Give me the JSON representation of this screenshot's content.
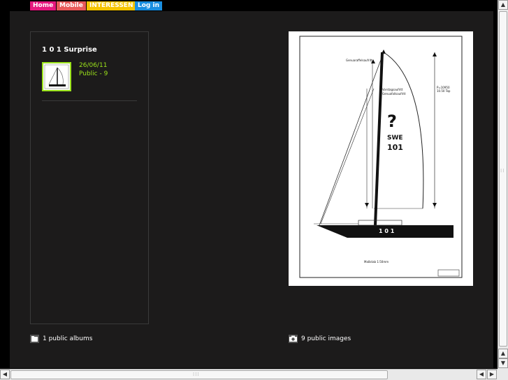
{
  "nav": [
    {
      "label": "Home",
      "color": "#e6197f"
    },
    {
      "label": "Mobile",
      "color": "#e85a5a"
    },
    {
      "label": "INTERESSEN",
      "color": "#f5c400"
    },
    {
      "label": "Log in",
      "color": "#1a8ee0"
    }
  ],
  "album": {
    "title": "1 0 1 Surprise",
    "date": "26/06/11",
    "visibility": "Public - 9",
    "thumbnail_icon": "sailboat-drawing-icon"
  },
  "image": {
    "drawing_labels": {
      "sail_number_country": "SWE",
      "sail_number": "101",
      "hull_number": "1 0 1",
      "caption": "Maßstab 1:50mm",
      "top_label": "Genuaraffelsaufritt",
      "mid_label_a": "Vorstagsaufritt",
      "mid_label_b": "Genuafallsaufritt",
      "right_label": "P=10950 10.50 Top",
      "symbol": "?"
    }
  },
  "footer": {
    "albums": "1 public albums",
    "images": "9 public images",
    "albums_icon": "album-icon",
    "images_icon": "camera-icon"
  }
}
